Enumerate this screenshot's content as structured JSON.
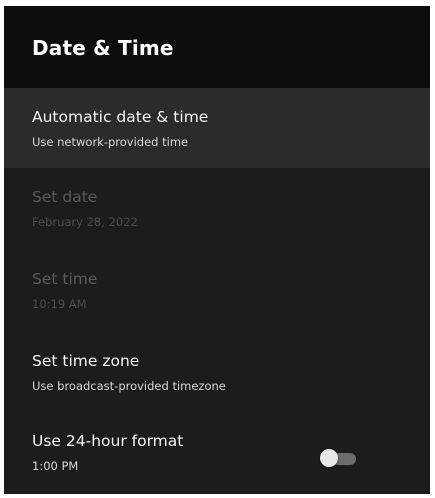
{
  "header": {
    "title": "Date & Time"
  },
  "items": [
    {
      "title": "Automatic date & time",
      "subtitle": "Use network-provided time"
    },
    {
      "title": "Set date",
      "subtitle": "February 28, 2022"
    },
    {
      "title": "Set time",
      "subtitle": "10:19 AM"
    },
    {
      "title": "Set time zone",
      "subtitle": "Use broadcast-provided timezone"
    },
    {
      "title": "Use 24-hour format",
      "subtitle": "1:00 PM",
      "toggle_on": false
    }
  ],
  "colors": {
    "panel_bg": "#1c1c1c",
    "header_bg": "#0d0d0d",
    "focus_bg": "#2b2b2b",
    "text_primary": "#f5f5f5",
    "text_disabled": "#5a5a5a"
  }
}
